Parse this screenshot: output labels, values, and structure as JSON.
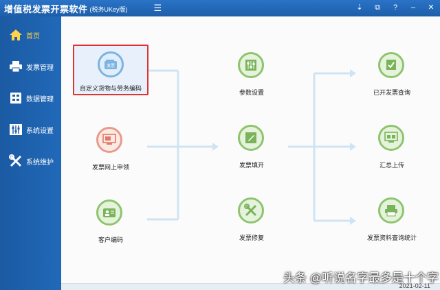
{
  "app": {
    "title": "增值税发票开票软件",
    "subtitle": "(税务UKey版)",
    "menu_icon": "menu-icon"
  },
  "window_controls": [
    "download-icon",
    "restore-icon",
    "help-icon",
    "minimize-icon",
    "close-icon"
  ],
  "sidebar": {
    "items": [
      {
        "label": "首页",
        "icon": "home-icon",
        "active": true
      },
      {
        "label": "发票管理",
        "icon": "printer-icon",
        "active": false
      },
      {
        "label": "数据管理",
        "icon": "data-icon",
        "active": false
      },
      {
        "label": "系统设置",
        "icon": "sliders-icon",
        "active": false
      },
      {
        "label": "系统维护",
        "icon": "tools-icon",
        "active": false
      }
    ]
  },
  "flow": {
    "col1": [
      {
        "label": "自定义货物与劳务编码",
        "icon": "wallet-icon",
        "color": "blue",
        "selected": true
      },
      {
        "label": "发票网上申领",
        "icon": "online-apply-icon",
        "color": "red"
      },
      {
        "label": "客户编码",
        "icon": "customer-icon",
        "color": "green"
      }
    ],
    "col2": [
      {
        "label": "参数设置",
        "icon": "settings-icon",
        "color": "green"
      },
      {
        "label": "发票填开",
        "icon": "edit-icon",
        "color": "green"
      },
      {
        "label": "发票修复",
        "icon": "repair-icon",
        "color": "green"
      }
    ],
    "col3": [
      {
        "label": "已开发票查询",
        "icon": "invoice-search-icon",
        "color": "green"
      },
      {
        "label": "汇总上传",
        "icon": "upload-icon",
        "color": "green"
      },
      {
        "label": "发票资料查询统计",
        "icon": "statistics-icon",
        "color": "green"
      }
    ]
  },
  "footer": {
    "date": "2021-02-11"
  },
  "watermark": "头条 @听说名字最多是十个字",
  "colors": {
    "sidebar": "#1f5ea8",
    "active_label": "#ffd34a",
    "connector": "#cfe4f3",
    "selected_border": "#dd3333"
  }
}
